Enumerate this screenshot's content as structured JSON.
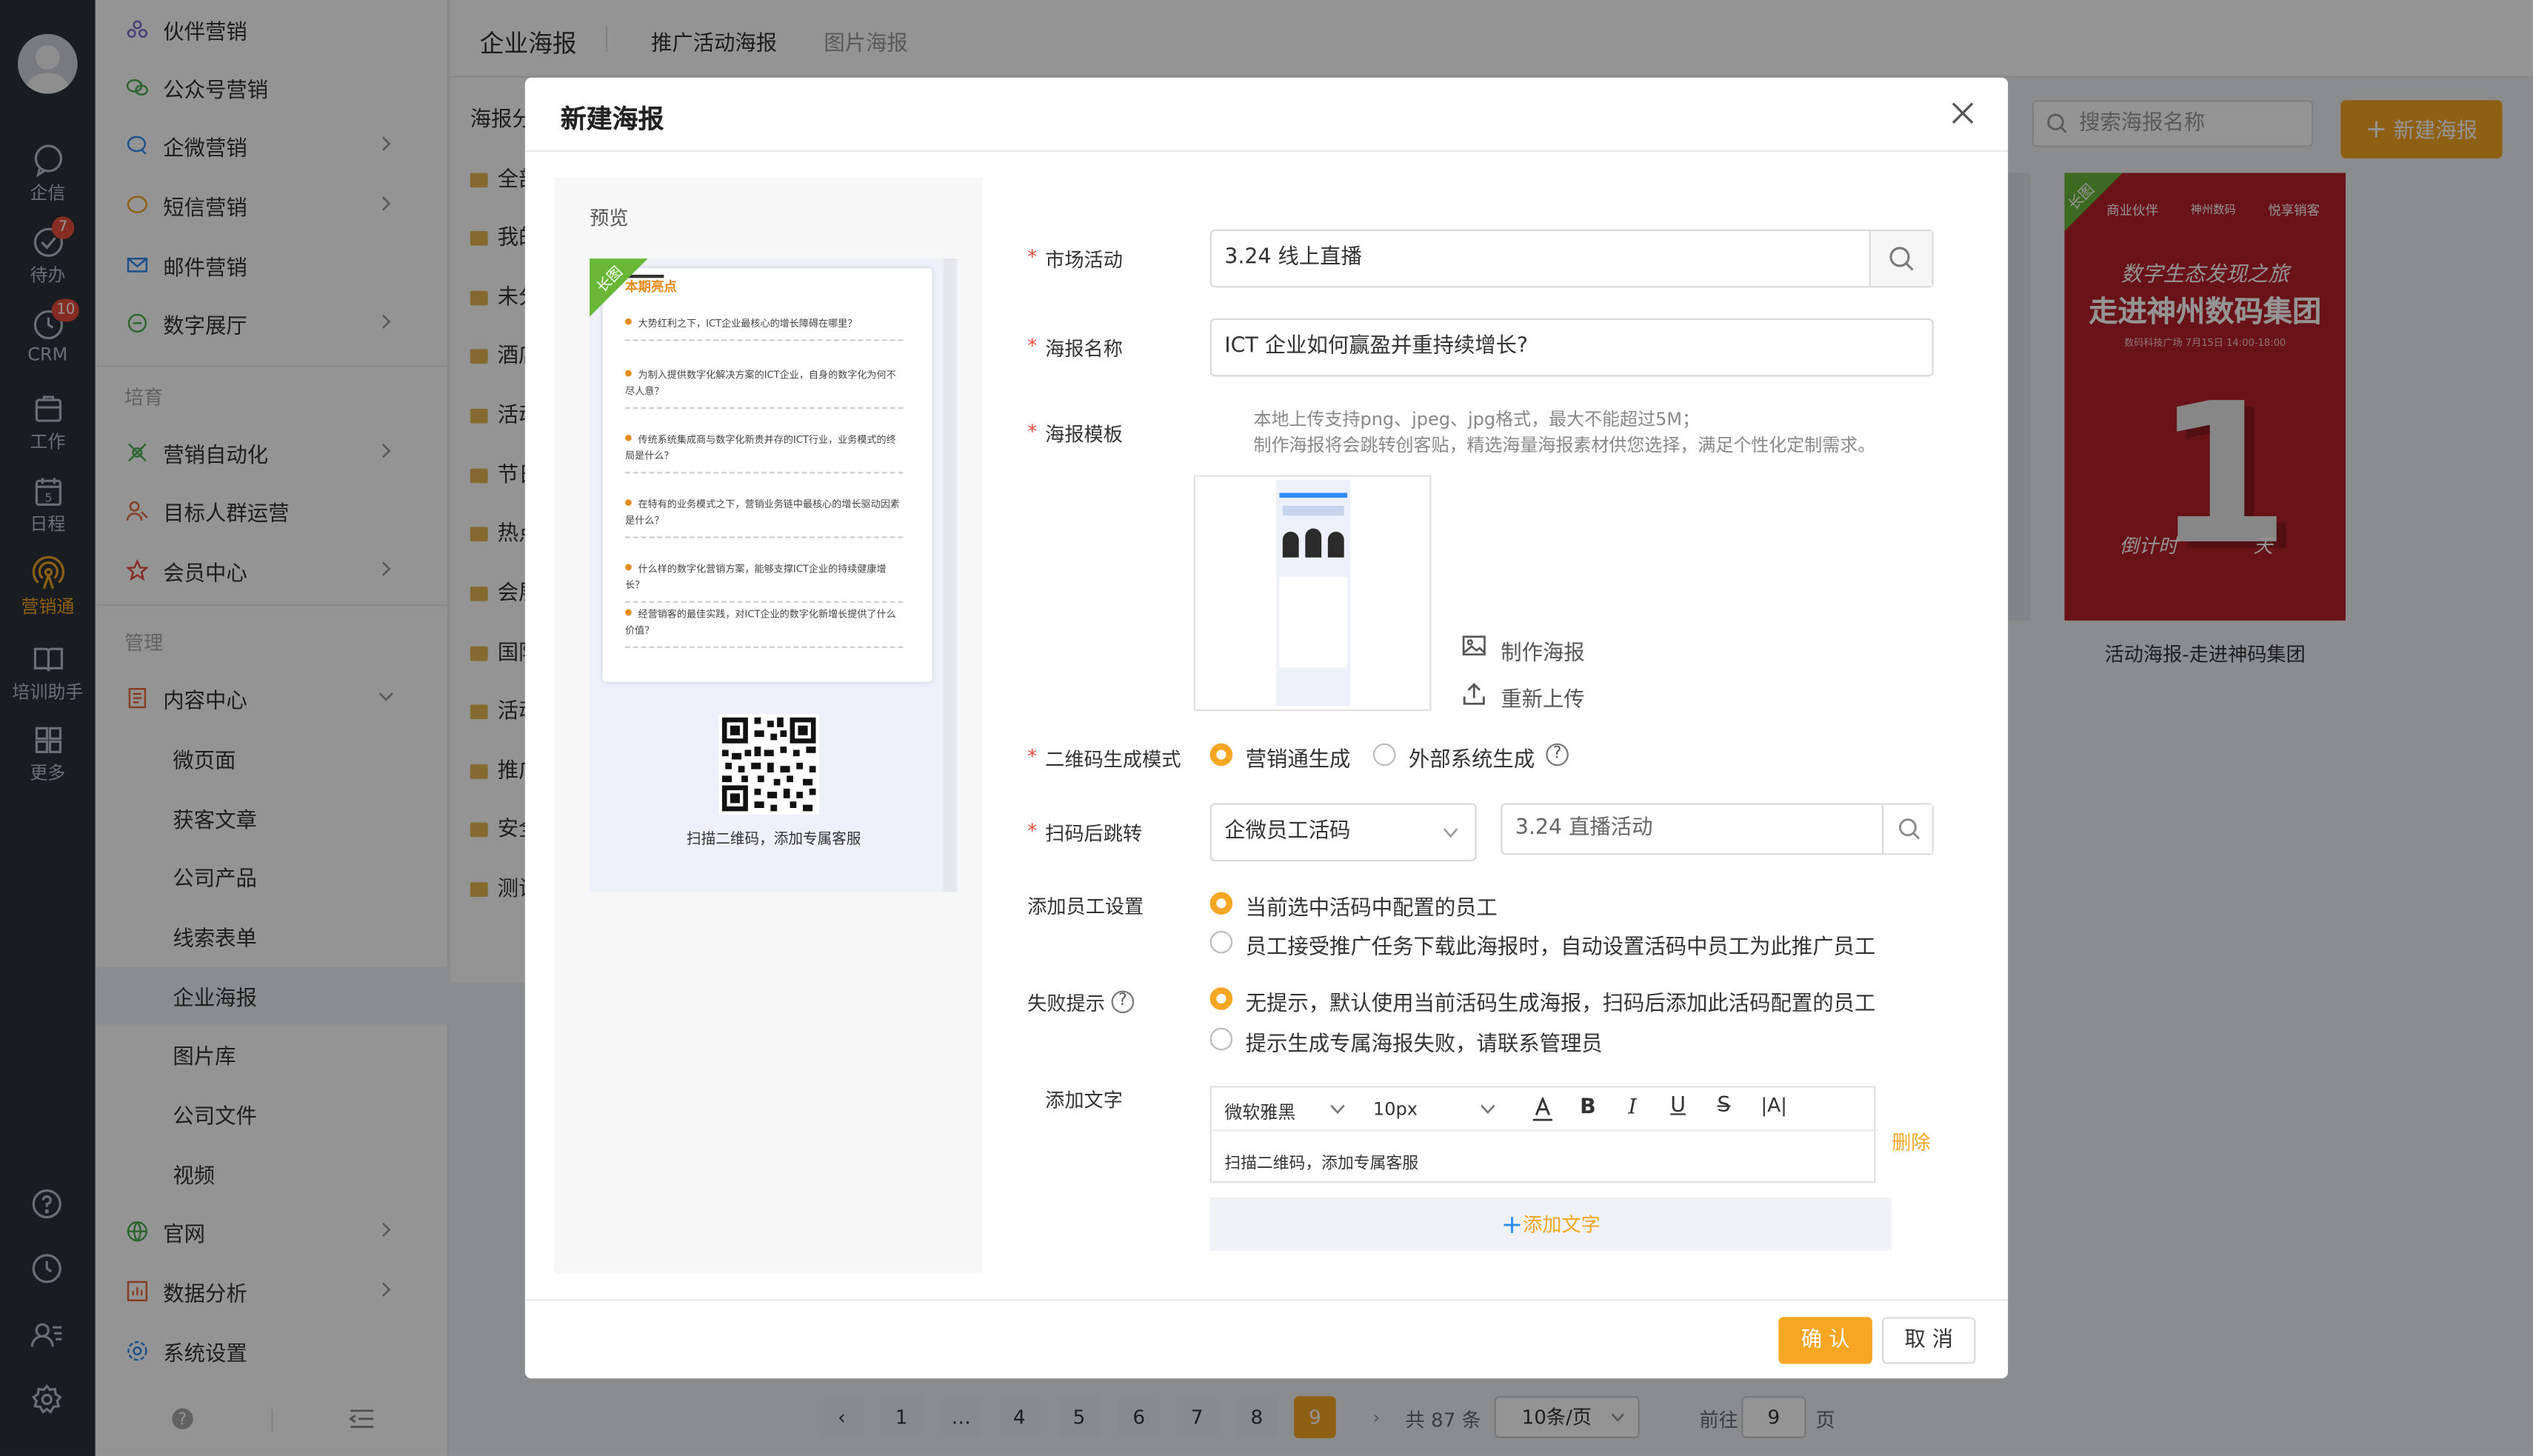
{
  "rail": {
    "items": [
      {
        "label": "企信",
        "icon": "chat-icon"
      },
      {
        "label": "待办",
        "icon": "check-circle-icon",
        "badge": "7"
      },
      {
        "label": "CRM",
        "icon": "clock-icon",
        "badge": "10"
      },
      {
        "label": "工作",
        "icon": "briefcase-icon"
      },
      {
        "label": "日程",
        "icon": "calendar-icon",
        "day": "5"
      },
      {
        "label": "营销通",
        "icon": "broadcast-icon"
      },
      {
        "label": "培训助手",
        "icon": "book-icon"
      },
      {
        "label": "更多",
        "icon": "grid-icon"
      }
    ],
    "bottom_icons": [
      "help-icon",
      "history-icon",
      "contacts-icon",
      "settings-icon"
    ],
    "active_color": "#f5a623"
  },
  "sidebar": {
    "items": [
      {
        "label": "伙伴营销",
        "icon": "partner-icon",
        "color": "#7a6bd6"
      },
      {
        "label": "公众号营销",
        "icon": "wechat-icon",
        "color": "#4caf50"
      },
      {
        "label": "企微营销",
        "icon": "wecom-icon",
        "color": "#2d8cf0"
      },
      {
        "label": "短信营销",
        "icon": "sms-icon",
        "color": "#f5a623"
      },
      {
        "label": "邮件营销",
        "icon": "mail-icon",
        "color": "#2d8cf0"
      },
      {
        "label": "数字展厅",
        "icon": "hall-icon",
        "color": "#4caf50"
      },
      {
        "label": "营销自动化",
        "icon": "automation-icon",
        "color": "#4caf50"
      },
      {
        "label": "目标人群运营",
        "icon": "audience-icon",
        "color": "#e86a3c"
      },
      {
        "label": "会员中心",
        "icon": "member-icon",
        "color": "#e84c3d"
      },
      {
        "label": "内容中心",
        "icon": "content-icon",
        "color": "#e86a3c"
      },
      {
        "label": "官网",
        "icon": "website-icon",
        "color": "#4caf50"
      },
      {
        "label": "数据分析",
        "icon": "analytics-icon",
        "color": "#e86a3c"
      },
      {
        "label": "系统设置",
        "icon": "settings-icon",
        "color": "#2d8cf0"
      }
    ],
    "sub_items": [
      "微页面",
      "获客文章",
      "公司产品",
      "线索表单",
      "企业海报",
      "图片库",
      "公司文件",
      "视频"
    ],
    "groups": {
      "cultivate": "培育",
      "manage": "管理"
    }
  },
  "tabs": {
    "main": "企业海报",
    "t1": "推广活动海报",
    "t2": "图片海报"
  },
  "folders": {
    "header": "海报分",
    "items": [
      "全部",
      "我的",
      "未分",
      "酒店",
      "活动",
      "节日",
      "热点",
      "会展",
      "国际",
      "活动",
      "推广",
      "安全",
      "测试"
    ]
  },
  "toolbar": {
    "search_placeholder": "搜索海报名称",
    "new_button": "新建海报"
  },
  "poster_card": {
    "tag": "长图",
    "brand_1": "商业伙伴",
    "brand_2": "神州数码",
    "brand_3": "悦享销客",
    "headline_1": "数字生态发现之旅",
    "headline_2": "走进神州数码集团",
    "meta": "数码科技广场 7月15日 14:00-18:00",
    "countdown_left": "倒计时",
    "countdown_right": "天",
    "big_number": "1",
    "caption": "活动海报-走进神码集团"
  },
  "pagination": {
    "pages": [
      "1",
      "…",
      "4",
      "5",
      "6",
      "7",
      "8",
      "9"
    ],
    "current": "9",
    "total_text": "共 87 条",
    "page_size": "10条/页",
    "goto_label": "前往",
    "goto_value": "9",
    "page_unit": "页"
  },
  "modal": {
    "title": "新建海报",
    "preview": {
      "label": "预览",
      "ribbon": "长图",
      "doc_header": "本期亮点",
      "questions": [
        "大势红利之下，ICT企业最核心的增长障碍在哪里？",
        "为制入提供数字化解决方案的ICT企业，自身的数字化为何不尽人意？",
        "传统系统集成商与数字化新贵并存的ICT行业，业务模式的终局是什么？",
        "在特有的业务模式之下，营销业务链中最核心的增长驱动因素是什么？",
        "什么样的数字化营销方案，能够支撑ICT企业的持续健康增长？",
        "经营销客的最佳实践，对ICT企业的数字化新增长提供了什么价值？"
      ],
      "qr_caption": "扫描二维码，添加专属客服"
    },
    "form": {
      "market_label": "市场活动",
      "market_value": "3.24 线上直播",
      "name_label": "海报名称",
      "name_value": "ICT 企业如何赢盈并重持续增长?",
      "template_label": "海报模板",
      "template_hint_1": "本地上传支持png、jpeg、jpg格式，最大不能超过5M；",
      "template_hint_2": "制作海报将会跳转创客贴，精选海量海报素材供您选择，满足个性化定制需求。",
      "make_poster": "制作海报",
      "reupload": "重新上传",
      "qr_mode_label": "二维码生成模式",
      "qr_mode_options": [
        "营销通生成",
        "外部系统生成"
      ],
      "qr_mode_selected": 0,
      "jump_label": "扫码后跳转",
      "jump_select": "企微员工活码",
      "jump_target_value": "3.24 直播活动",
      "staff_label": "添加员工设置",
      "staff_options": [
        "当前选中活码中配置的员工",
        "员工接受推广任务下载此海报时，自动设置活码中员工为此推广员工"
      ],
      "staff_selected": 0,
      "fail_label": "失败提示",
      "fail_options": [
        "无提示，默认使用当前活码生成海报，扫码后添加此活码配置的员工",
        "提示生成专属海报失败，请联系管理员"
      ],
      "fail_selected": 0,
      "text_label": "添加文字",
      "font_family": "微软雅黑",
      "font_size": "10px",
      "editor_text": "扫描二维码，添加专属客服",
      "delete": "删除",
      "add_text": "添加文字"
    },
    "ok": "确 认",
    "cancel": "取 消"
  },
  "colors": {
    "accent": "#f5a623",
    "danger": "#e84c3d",
    "rail_bg": "#2c323c",
    "poster_red": "#b5202a"
  }
}
